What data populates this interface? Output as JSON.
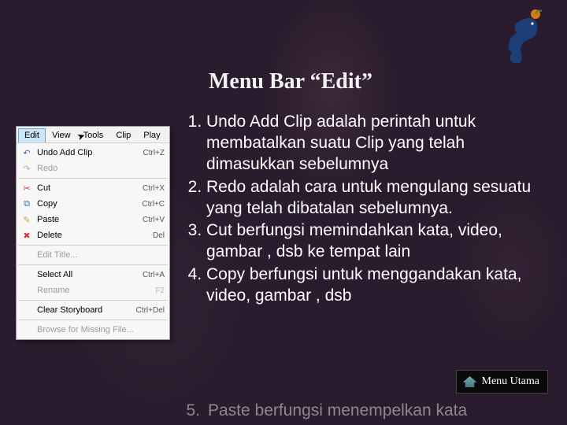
{
  "title": "Menu Bar “Edit”",
  "logo_name": "seahorse-icon",
  "menubar": {
    "items": [
      "Edit",
      "View",
      "Tools",
      "Clip",
      "Play"
    ],
    "selected_index": 0
  },
  "dropdown": {
    "groups": [
      [
        {
          "icon": "undo-icon",
          "icon_glyph": "↶",
          "icon_color": "#2b6fb3",
          "label": "Undo Add Clip",
          "shortcut": "Ctrl+Z",
          "enabled": true
        },
        {
          "icon": "redo-icon",
          "icon_glyph": "↷",
          "icon_color": "#b0b0b0",
          "label": "Redo",
          "shortcut": "",
          "enabled": false
        }
      ],
      [
        {
          "icon": "cut-icon",
          "icon_glyph": "✂",
          "icon_color": "#d33",
          "label": "Cut",
          "shortcut": "Ctrl+X",
          "enabled": true
        },
        {
          "icon": "copy-icon",
          "icon_glyph": "⧉",
          "icon_color": "#2b6fb3",
          "label": "Copy",
          "shortcut": "Ctrl+C",
          "enabled": true
        },
        {
          "icon": "paste-icon",
          "icon_glyph": "✎",
          "icon_color": "#c6a24a",
          "label": "Paste",
          "shortcut": "Ctrl+V",
          "enabled": true
        },
        {
          "icon": "delete-icon",
          "icon_glyph": "✖",
          "icon_color": "#d33",
          "label": "Delete",
          "shortcut": "Del",
          "enabled": true
        }
      ],
      [
        {
          "icon": "",
          "icon_glyph": "",
          "icon_color": "",
          "label": "Edit Title...",
          "shortcut": "",
          "enabled": false
        }
      ],
      [
        {
          "icon": "",
          "icon_glyph": "",
          "icon_color": "",
          "label": "Select All",
          "shortcut": "Ctrl+A",
          "enabled": true
        },
        {
          "icon": "",
          "icon_glyph": "",
          "icon_color": "",
          "label": "Rename",
          "shortcut": "F2",
          "enabled": false
        }
      ],
      [
        {
          "icon": "",
          "icon_glyph": "",
          "icon_color": "",
          "label": "Clear Storyboard",
          "shortcut": "Ctrl+Del",
          "enabled": true
        }
      ],
      [
        {
          "icon": "",
          "icon_glyph": "",
          "icon_color": "",
          "label": "Browse for Missing File...",
          "shortcut": "",
          "enabled": false
        }
      ]
    ]
  },
  "list": {
    "items": [
      "Undo Add Clip adalah perintah untuk membatalkan suatu Clip yang telah dimasukkan sebelumnya",
      "Redo adalah cara untuk mengulang sesuatu yang telah dibatalan sebelumnya.",
      "Cut berfungsi memindahkan kata, video, gambar , dsb ke tempat lain",
      "Copy berfungsi untuk menggandakan kata, video, gambar , dsb"
    ]
  },
  "cutoff": {
    "number": "5.",
    "text": "Paste berfungsi menempelkan kata"
  },
  "home_button": {
    "label": "Menu Utama"
  }
}
